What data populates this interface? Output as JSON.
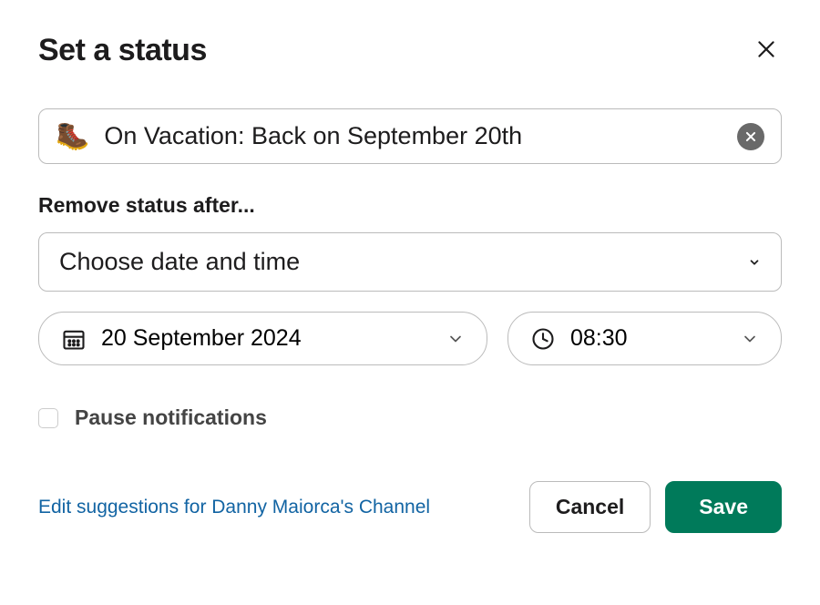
{
  "header": {
    "title": "Set a status"
  },
  "status": {
    "emoji": "🥾",
    "text": "On Vacation: Back on September 20th"
  },
  "removeAfter": {
    "label": "Remove status after...",
    "selectLabel": "Choose date and time",
    "date": "20 September 2024",
    "time": "08:30"
  },
  "pauseNotifications": {
    "label": "Pause notifications",
    "checked": false
  },
  "footer": {
    "editLink": "Edit suggestions for Danny Maiorca's Channel",
    "cancel": "Cancel",
    "save": "Save"
  }
}
